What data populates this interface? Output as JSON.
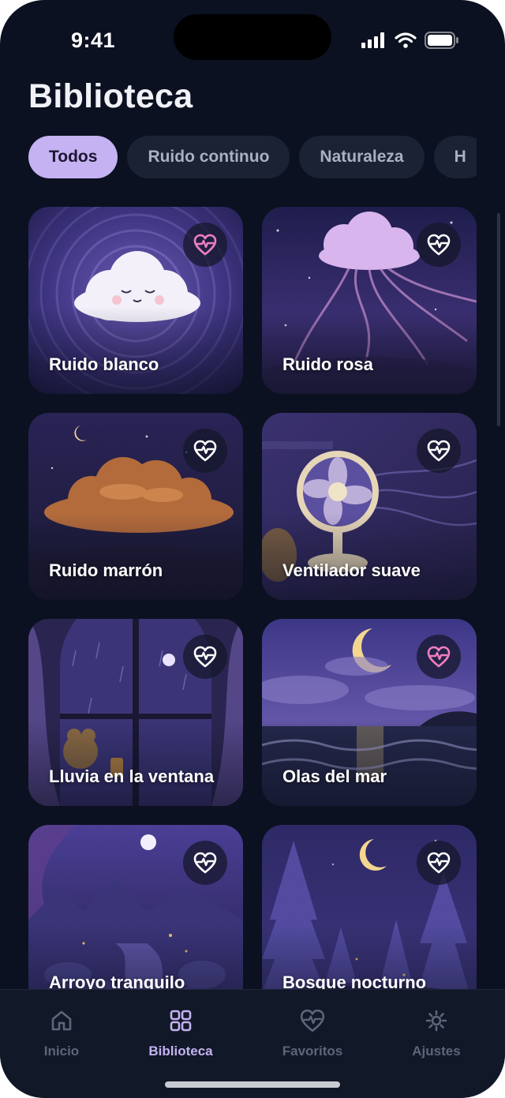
{
  "status_bar": {
    "time": "9:41"
  },
  "page": {
    "title": "Biblioteca"
  },
  "filters": [
    "Todos",
    "Ruido continuo",
    "Naturaleza",
    "H"
  ],
  "sounds": [
    {
      "label": "Ruido blanco",
      "favorite": true
    },
    {
      "label": "Ruido rosa",
      "favorite": false
    },
    {
      "label": "Ruido marrón",
      "favorite": false
    },
    {
      "label": "Ventilador suave",
      "favorite": false
    },
    {
      "label": "Lluvia en la ventana",
      "favorite": false
    },
    {
      "label": "Olas del mar",
      "favorite": true
    },
    {
      "label": "Arroyo tranquilo",
      "favorite": false
    },
    {
      "label": "Bosque nocturno",
      "favorite": false
    }
  ],
  "tabbar": {
    "items": [
      {
        "label": "Inicio",
        "icon": "home-icon"
      },
      {
        "label": "Biblioteca",
        "icon": "grid-icon"
      },
      {
        "label": "Favoritos",
        "icon": "heart-pulse-icon"
      },
      {
        "label": "Ajustes",
        "icon": "settings-icon"
      }
    ],
    "active": "Biblioteca"
  },
  "colors": {
    "background": "#0b1120",
    "accent": "#c4b2f2",
    "favorite_active": "#f07fc1",
    "favorite_inactive": "#ffffff"
  }
}
